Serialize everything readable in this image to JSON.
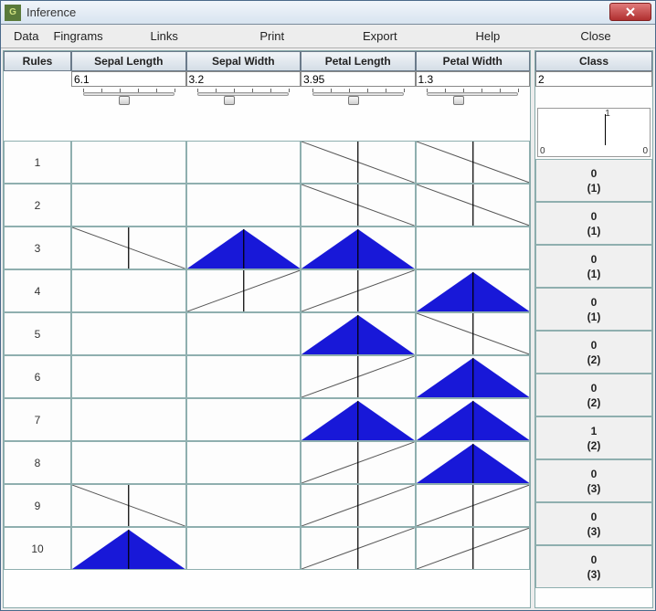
{
  "window": {
    "title": "Inference"
  },
  "menu": {
    "data": "Data",
    "fingrams": "Fingrams",
    "links": "Links",
    "print": "Print",
    "export": "Export",
    "help": "Help",
    "close": "Close"
  },
  "columns": {
    "rules": "Rules",
    "features": [
      "Sepal Length",
      "Sepal Width",
      "Petal Length",
      "Petal Width"
    ],
    "class": "Class"
  },
  "inputs": {
    "values": [
      "6.1",
      "3.2",
      "3.95",
      "1.3"
    ],
    "class_value": "2",
    "slider_pos": [
      0.45,
      0.35,
      0.45,
      0.35
    ]
  },
  "mini_axis": {
    "left": "0",
    "mid": "1",
    "right": "0"
  },
  "rows": [
    {
      "num": "1",
      "cells": [
        "empty",
        "empty",
        "dl",
        "dl"
      ],
      "class_top": "0",
      "class_bot": "(1)"
    },
    {
      "num": "2",
      "cells": [
        "empty",
        "empty",
        "dl",
        "dl"
      ],
      "class_top": "0",
      "class_bot": "(1)"
    },
    {
      "num": "3",
      "cells": [
        "dl",
        "tri",
        "tri",
        "empty"
      ],
      "class_top": "0",
      "class_bot": "(1)"
    },
    {
      "num": "4",
      "cells": [
        "empty",
        "dr",
        "dr",
        "tri"
      ],
      "class_top": "0",
      "class_bot": "(1)"
    },
    {
      "num": "5",
      "cells": [
        "empty",
        "empty",
        "tri",
        "dl"
      ],
      "class_top": "0",
      "class_bot": "(2)"
    },
    {
      "num": "6",
      "cells": [
        "empty",
        "empty",
        "dr",
        "tri"
      ],
      "class_top": "0",
      "class_bot": "(2)"
    },
    {
      "num": "7",
      "cells": [
        "empty",
        "empty",
        "tri",
        "tri"
      ],
      "class_top": "1",
      "class_bot": "(2)"
    },
    {
      "num": "8",
      "cells": [
        "empty",
        "empty",
        "dr",
        "tri"
      ],
      "class_top": "0",
      "class_bot": "(3)"
    },
    {
      "num": "9",
      "cells": [
        "dl",
        "empty",
        "dr",
        "dr"
      ],
      "class_top": "0",
      "class_bot": "(3)"
    },
    {
      "num": "10",
      "cells": [
        "tri",
        "empty",
        "dr",
        "dr"
      ],
      "class_top": "0",
      "class_bot": "(3)"
    }
  ]
}
